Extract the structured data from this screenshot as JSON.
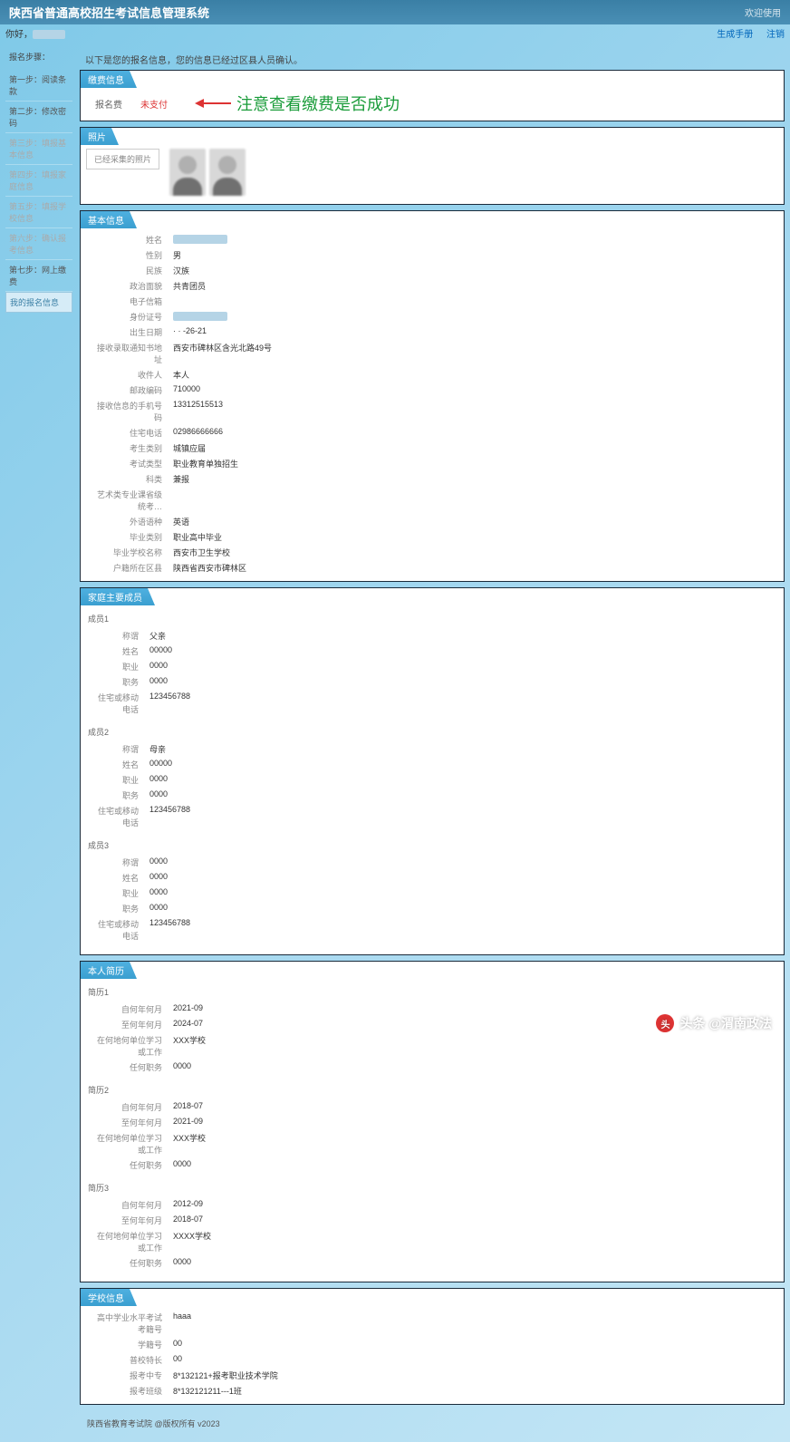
{
  "header": {
    "title": "陕西省普通高校招生考试信息管理系统",
    "right": "欢迎使用"
  },
  "top": {
    "greeting": "你好，",
    "link1": "生成手册",
    "link2": "注销"
  },
  "sidebar": {
    "label1": "报名步骤：",
    "steps": [
      {
        "label": "第一步：阅读条款",
        "active": false
      },
      {
        "label": "第二步：修改密码",
        "active": false
      },
      {
        "label": "第三步：填报基本信息",
        "active": false,
        "dim": true
      },
      {
        "label": "第四步：填报家庭信息",
        "active": false,
        "dim": true
      },
      {
        "label": "第五步：填报学校信息",
        "active": false,
        "dim": true
      },
      {
        "label": "第六步：确认报考信息",
        "active": false,
        "dim": true
      },
      {
        "label": "第七步：网上缴费",
        "active": false
      },
      {
        "label": "我的报名信息",
        "active": true
      }
    ]
  },
  "notice": "以下是您的报名信息，您的信息已经过区县人员确认。",
  "annotation": "注意查看缴费是否成功",
  "panels": {
    "fee": {
      "title": "缴费信息",
      "label": "报名费",
      "status": "未支付"
    },
    "photo": {
      "title": "照片",
      "upload": "已经采集的照片"
    },
    "basic": {
      "title": "基本信息",
      "rows": [
        {
          "label": "姓名",
          "value": "",
          "redact": true
        },
        {
          "label": "性别",
          "value": "男"
        },
        {
          "label": "民族",
          "value": "汉族"
        },
        {
          "label": "政治面貌",
          "value": "共青团员"
        },
        {
          "label": "电子信箱",
          "value": ""
        },
        {
          "label": "身份证号",
          "value": "",
          "redact": true
        },
        {
          "label": "出生日期",
          "value": "·  ·  -26-21"
        },
        {
          "label": "接收录取通知书地址",
          "value": "西安市碑林区含光北路49号"
        },
        {
          "label": "收件人",
          "value": "本人"
        },
        {
          "label": "邮政编码",
          "value": "710000"
        },
        {
          "label": "接收信息的手机号码",
          "value": "13312515513"
        },
        {
          "label": "住宅电话",
          "value": "02986666666"
        },
        {
          "label": "考生类别",
          "value": "城镇应届"
        },
        {
          "label": "考试类型",
          "value": "职业教育单独招生"
        },
        {
          "label": "科类",
          "value": "兼报"
        },
        {
          "label": "艺术类专业课省级统考…",
          "value": ""
        },
        {
          "label": "外语语种",
          "value": "英语"
        },
        {
          "label": "毕业类别",
          "value": "职业高中毕业"
        },
        {
          "label": "毕业学校名称",
          "value": "西安市卫生学校"
        },
        {
          "label": "户籍所在区县",
          "value": "陕西省西安市碑林区"
        }
      ]
    },
    "family": {
      "title": "家庭主要成员",
      "members": [
        {
          "name": "成员1",
          "rows": [
            {
              "label": "称谓",
              "value": "父亲"
            },
            {
              "label": "姓名",
              "value": "00000"
            },
            {
              "label": "职业",
              "value": "0000"
            },
            {
              "label": "职务",
              "value": "0000"
            },
            {
              "label": "住宅或移动电话",
              "value": "123456788"
            }
          ]
        },
        {
          "name": "成员2",
          "rows": [
            {
              "label": "称谓",
              "value": "母亲"
            },
            {
              "label": "姓名",
              "value": "00000"
            },
            {
              "label": "职业",
              "value": "0000"
            },
            {
              "label": "职务",
              "value": "0000"
            },
            {
              "label": "住宅或移动电话",
              "value": "123456788"
            }
          ]
        },
        {
          "name": "成员3",
          "rows": [
            {
              "label": "称谓",
              "value": "0000"
            },
            {
              "label": "姓名",
              "value": "0000"
            },
            {
              "label": "职业",
              "value": "0000"
            },
            {
              "label": "职务",
              "value": "0000"
            },
            {
              "label": "住宅或移动电话",
              "value": "123456788"
            }
          ]
        }
      ]
    },
    "resume": {
      "title": "本人简历",
      "items": [
        {
          "name": "简历1",
          "rows": [
            {
              "label": "自何年何月",
              "value": "2021-09"
            },
            {
              "label": "至何年何月",
              "value": "2024-07"
            },
            {
              "label": "在何地何单位学习或工作",
              "value": "XXX学校"
            },
            {
              "label": "任何职务",
              "value": "0000"
            }
          ]
        },
        {
          "name": "简历2",
          "rows": [
            {
              "label": "自何年何月",
              "value": "2018-07"
            },
            {
              "label": "至何年何月",
              "value": "2021-09"
            },
            {
              "label": "在何地何单位学习或工作",
              "value": "XXX学校"
            },
            {
              "label": "任何职务",
              "value": "0000"
            }
          ]
        },
        {
          "name": "简历3",
          "rows": [
            {
              "label": "自何年何月",
              "value": "2012-09"
            },
            {
              "label": "至何年何月",
              "value": "2018-07"
            },
            {
              "label": "在何地何单位学习或工作",
              "value": "XXXX学校"
            },
            {
              "label": "任何职务",
              "value": "0000"
            }
          ]
        }
      ]
    },
    "school": {
      "title": "学校信息",
      "rows": [
        {
          "label": "高中学业水平考试考籍号",
          "value": "haaa"
        },
        {
          "label": "学籍号",
          "value": "00"
        },
        {
          "label": "普校特长",
          "value": "00"
        },
        {
          "label": "报考中专",
          "value": "8*132121+报考职业技术学院"
        },
        {
          "label": "报考班级",
          "value": "8*132121211---1班"
        }
      ]
    }
  },
  "footer": "陕西省教育考试院 @版权所有 v2023",
  "watermark": "头条 @渭南政法"
}
